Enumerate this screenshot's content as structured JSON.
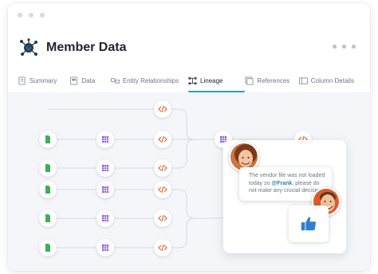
{
  "header": {
    "title": "Member Data",
    "more_icon": "more-dots-icon",
    "logo_icon": "data-network-logo"
  },
  "tabs": [
    {
      "label": "Summary",
      "icon": "summary-icon",
      "active": false
    },
    {
      "label": "Data",
      "icon": "data-icon",
      "active": false
    },
    {
      "label": "Entity Relationships",
      "icon": "entity-relationships-icon",
      "active": false
    },
    {
      "label": "Lineage",
      "icon": "lineage-icon",
      "active": true
    },
    {
      "label": "References",
      "icon": "references-icon",
      "active": false
    },
    {
      "label": "Column Details",
      "icon": "column-details-icon",
      "active": false
    }
  ],
  "colors": {
    "accent": "#2aa1c4",
    "file_node": "#3fae5a",
    "table_node": "#8a5bd6",
    "code_node": "#e8653b",
    "like": "#2f7fd1"
  },
  "lineage": {
    "node_types": [
      "file-icon",
      "table-icon",
      "code-icon"
    ]
  },
  "comment": {
    "text_before": "The vendor file was not loaded today so ",
    "mention": "@Frank",
    "text_after": ", please do not make any crucial decision.",
    "reaction_icon": "thumbs-up-icon"
  }
}
